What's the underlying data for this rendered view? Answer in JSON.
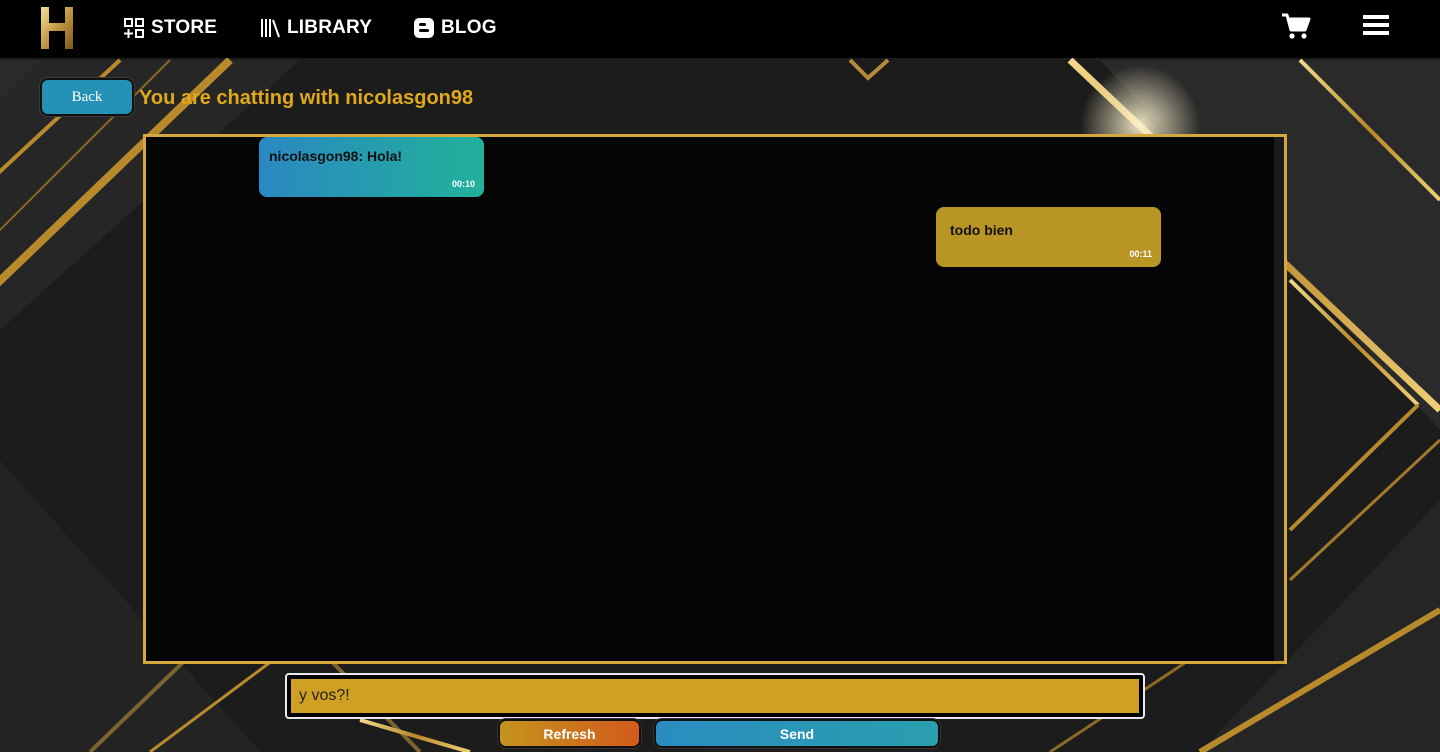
{
  "nav": {
    "items": [
      {
        "label": "STORE",
        "icon": "store-grid-icon"
      },
      {
        "label": "LIBRARY",
        "icon": "library-books-icon"
      },
      {
        "label": "BLOG",
        "icon": "blogger-icon"
      }
    ],
    "cart_icon": "shopping-cart-icon",
    "menu_icon": "hamburger-menu-icon"
  },
  "chat": {
    "back_label": "Back",
    "title": "You are chatting with nicolasgon98",
    "messages": [
      {
        "text": "nicolasgon98: Hola!",
        "time": "00:10",
        "direction": "incoming"
      },
      {
        "text": "todo bien",
        "time": "00:11",
        "direction": "outgoing"
      }
    ],
    "input_value": "y vos?!",
    "refresh_label": "Refresh",
    "send_label": "Send"
  },
  "colors": {
    "accent_gold": "#d6a73b",
    "title_gold": "#e0a91a",
    "incoming_gradient": [
      "#2a88c2",
      "#21b19a"
    ],
    "outgoing_bubble": "#b89524",
    "input_bg": "#cfa022",
    "refresh_gradient": [
      "#c4931e",
      "#d25a1c"
    ],
    "send_gradient": [
      "#2a8cc0",
      "#2a9fae"
    ]
  }
}
